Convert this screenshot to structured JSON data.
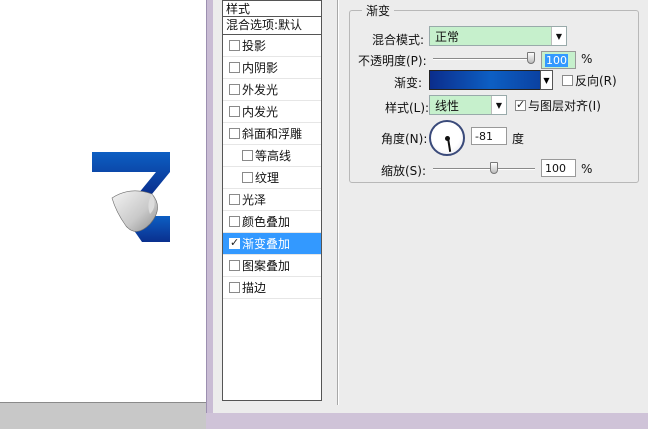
{
  "style_list": {
    "header": "样式",
    "blend_default": "混合选项:默认",
    "items": [
      {
        "label": "投影",
        "checked": false,
        "indent": false,
        "selected": false
      },
      {
        "label": "内阴影",
        "checked": false,
        "indent": false,
        "selected": false
      },
      {
        "label": "外发光",
        "checked": false,
        "indent": false,
        "selected": false
      },
      {
        "label": "内发光",
        "checked": false,
        "indent": false,
        "selected": false
      },
      {
        "label": "斜面和浮雕",
        "checked": false,
        "indent": false,
        "selected": false
      },
      {
        "label": "等高线",
        "checked": false,
        "indent": true,
        "selected": false
      },
      {
        "label": "纹理",
        "checked": false,
        "indent": true,
        "selected": false
      },
      {
        "label": "光泽",
        "checked": false,
        "indent": false,
        "selected": false
      },
      {
        "label": "颜色叠加",
        "checked": false,
        "indent": false,
        "selected": false
      },
      {
        "label": "渐变叠加",
        "checked": true,
        "indent": false,
        "selected": true
      },
      {
        "label": "图案叠加",
        "checked": false,
        "indent": false,
        "selected": false
      },
      {
        "label": "描边",
        "checked": false,
        "indent": false,
        "selected": false
      }
    ]
  },
  "gradient_overlay": {
    "group_title": "渐变",
    "blend_mode_label": "混合模式:",
    "blend_mode_value": "正常",
    "opacity_label": "不透明度(P):",
    "opacity_value": "100",
    "opacity_unit": "%",
    "gradient_label": "渐变:",
    "reverse_label": "反向(R)",
    "reverse_checked": false,
    "style_label": "样式(L):",
    "style_value": "线性",
    "align_label": "与图层对齐(I)",
    "align_checked": true,
    "angle_label": "角度(N):",
    "angle_value": "-81",
    "angle_unit": "度",
    "scale_label": "缩放(S):",
    "scale_value": "100",
    "scale_unit": "%"
  },
  "colors": {
    "selection": "#3399ff",
    "select_bg": "#c6f0cc",
    "gradient_start": "#0b2d8c",
    "gradient_end": "#0d5fc3"
  }
}
